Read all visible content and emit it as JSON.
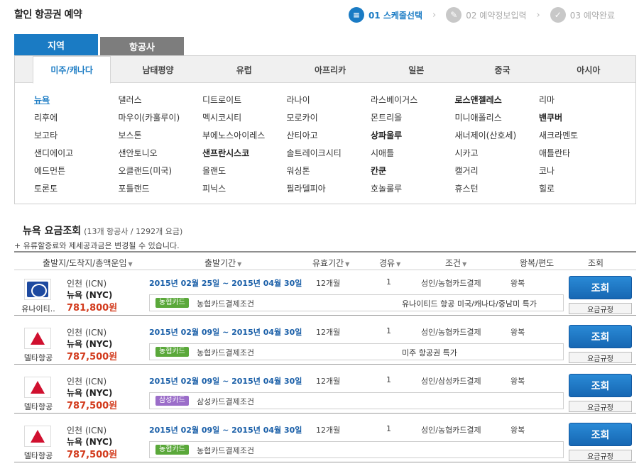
{
  "page_title": "할인 항공권 예약",
  "steps": [
    {
      "label": "01 스케줄선택",
      "icon": "schedule-icon",
      "active": true
    },
    {
      "label": "02 예약정보입력",
      "icon": "pencil-icon",
      "active": false
    },
    {
      "label": "03 예약완료",
      "icon": "check-icon",
      "active": false
    }
  ],
  "top_tabs": {
    "region": "지역",
    "airline": "항공사"
  },
  "region_tabs": [
    "미주/캐나다",
    "남태평양",
    "유럽",
    "아프리카",
    "일본",
    "중국",
    "아시아"
  ],
  "cities": [
    "뉴욕",
    "댈러스",
    "디트로이트",
    "라나이",
    "라스베이거스",
    "로스앤젤레스",
    "리마",
    "리후에",
    "마우이(카훌루이)",
    "멕시코시티",
    "모로카이",
    "몬트리올",
    "미니애폴리스",
    "밴쿠버",
    "보고타",
    "보스톤",
    "부에노스아이레스",
    "산티아고",
    "상파울루",
    "새너제이(산호세)",
    "새크라멘토",
    "샌디에이고",
    "샌안토니오",
    "샌프란시스코",
    "솔트레이크시티",
    "시애틀",
    "시카고",
    "애틀란타",
    "에드먼튼",
    "오클랜드(미국)",
    "올랜도",
    "워싱톤",
    "칸쿤",
    "캘거리",
    "코나",
    "토론토",
    "포틀랜드",
    "피닉스",
    "필라델피아",
    "호놀룰루",
    "휴스턴",
    "힐로"
  ],
  "result": {
    "title": "뉴욕 요금조회",
    "count": "(13개 항공사 / 1292개 요금)",
    "notice": "+ 유류할증료와 제세공과금은 변경될 수 있습니다."
  },
  "columns": {
    "route": "출발지/도착지/총액운임",
    "period": "출발기간",
    "validity": "유효기간",
    "stops": "경유",
    "condition": "조건",
    "trip": "왕복/편도",
    "action": "조회"
  },
  "fares": [
    {
      "airline": "유나이티..",
      "logo": "united-logo",
      "from": "인천 (ICN)",
      "to": "뉴욕 (NYC)",
      "price": "781,800원",
      "period": "2015년 02월 25일 ~ 2015년 04월 30일",
      "validity": "12개월",
      "stops": "1",
      "condition": "성인/농협카드결제",
      "trip": "왕복",
      "card_badge": "농협카드",
      "card_color": "green",
      "card_text": "농협카드결제조건",
      "promo": "유나이티드 항공 미국/캐나다/중남미 특가",
      "btn": "조회",
      "rule": "요금규정"
    },
    {
      "airline": "델타항공",
      "logo": "delta-logo",
      "from": "인천 (ICN)",
      "to": "뉴욕 (NYC)",
      "price": "787,500원",
      "period": "2015년 02월 09일 ~ 2015년 04월 30일",
      "validity": "12개월",
      "stops": "1",
      "condition": "성인/농협카드결제",
      "trip": "왕복",
      "card_badge": "농협카드",
      "card_color": "green",
      "card_text": "농협카드결제조건",
      "promo": "미주 항공권 특가",
      "btn": "조회",
      "rule": "요금규정"
    },
    {
      "airline": "델타항공",
      "logo": "delta-logo",
      "from": "인천 (ICN)",
      "to": "뉴욕 (NYC)",
      "price": "787,500원",
      "period": "2015년 02월 09일 ~ 2015년 04월 30일",
      "validity": "12개월",
      "stops": "1",
      "condition": "성인/삼성카드결제",
      "trip": "왕복",
      "card_badge": "삼성카드",
      "card_color": "purple",
      "card_text": "삼성카드결제조건",
      "promo": "",
      "btn": "조회",
      "rule": "요금규정"
    },
    {
      "airline": "델타항공",
      "logo": "delta-logo",
      "from": "인천 (ICN)",
      "to": "뉴욕 (NYC)",
      "price": "787,500원",
      "period": "2015년 02월 09일 ~ 2015년 04월 30일",
      "validity": "12개월",
      "stops": "1",
      "condition": "성인/농협카드결제",
      "trip": "왕복",
      "card_badge": "농협카드",
      "card_color": "green",
      "card_text": "농협카드결제조건",
      "promo": "",
      "btn": "조회",
      "rule": "요금규정"
    }
  ]
}
